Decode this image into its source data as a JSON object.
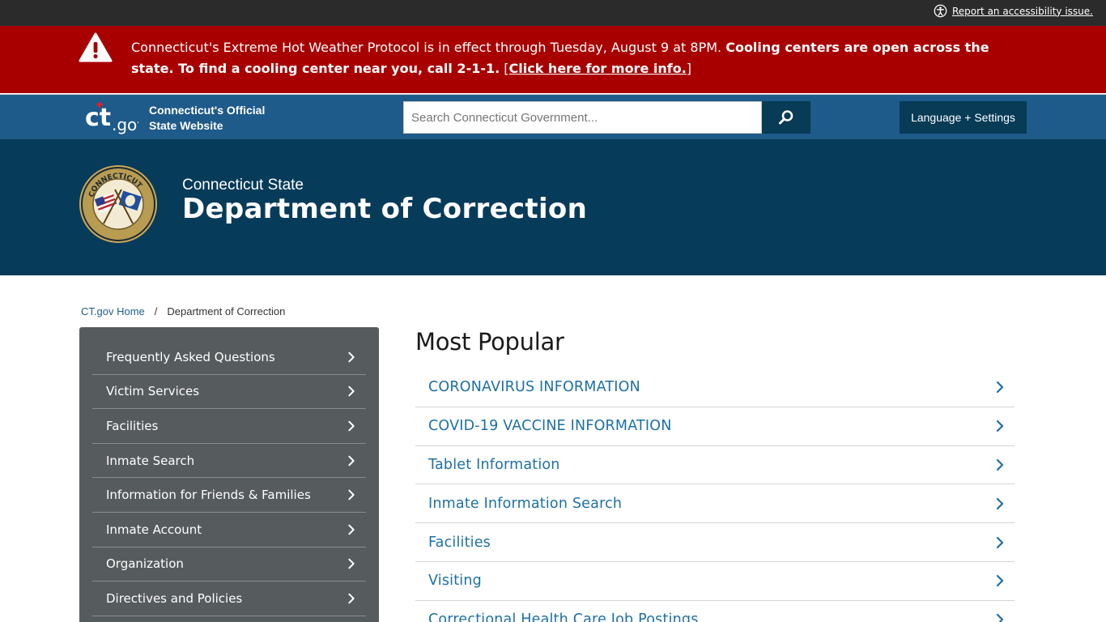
{
  "utility": {
    "accessibility_label": "Report an accessibility issue."
  },
  "alert": {
    "text_normal": "Connecticut's Extreme Hot Weather Protocol is in effect through Tuesday, August 9 at 8PM. ",
    "text_bold": "Cooling centers are open across the state. To find a cooling center near you, call 2-1-1.",
    "link_open": " [",
    "link_text": "Click here for more info.",
    "link_close": "]"
  },
  "header": {
    "tagline_line1": "Connecticut's Official",
    "tagline_line2": "State Website",
    "search_placeholder": "Search Connecticut Government...",
    "language_button": "Language + Settings"
  },
  "agency": {
    "subtitle": "Connecticut State",
    "title": "Department of Correction"
  },
  "breadcrumb": {
    "home": "CT.gov Home",
    "separator": "/",
    "current": "Department of Correction"
  },
  "sidebar": {
    "items": [
      {
        "label": "Frequently Asked Questions"
      },
      {
        "label": "Victim Services"
      },
      {
        "label": "Facilities"
      },
      {
        "label": "Inmate Search"
      },
      {
        "label": "Information for Friends & Families"
      },
      {
        "label": "Inmate Account"
      },
      {
        "label": "Organization"
      },
      {
        "label": "Directives and Policies"
      }
    ]
  },
  "most_popular": {
    "title": "Most Popular",
    "items": [
      {
        "label": "CORONAVIRUS INFORMATION"
      },
      {
        "label": "COVID-19 VACCINE INFORMATION"
      },
      {
        "label": "Tablet Information"
      },
      {
        "label": "Inmate Information Search"
      },
      {
        "label": "Facilities"
      },
      {
        "label": "Visiting"
      },
      {
        "label": "Correctional Health Care Job Postings"
      }
    ]
  },
  "icons": {
    "accessibility": "accessibility-icon",
    "alert": "warning-triangle-icon",
    "search": "search-icon",
    "chevron": "chevron-right-icon",
    "seal": "doc-seal-icon"
  },
  "colors": {
    "alert_bg": "#a80000",
    "header_bg": "#1e5a8a",
    "agency_bg": "#073b5a",
    "sidebar_bg": "#565b5e",
    "link": "#1d6fa5"
  }
}
